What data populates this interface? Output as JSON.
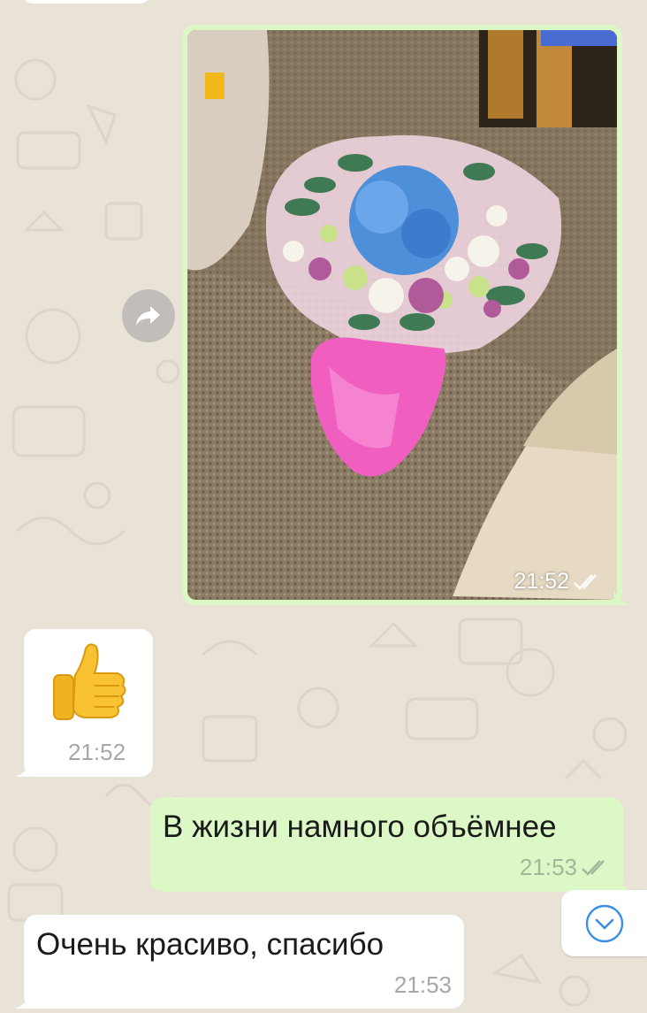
{
  "chat": {
    "messages": [
      {
        "type": "image",
        "direction": "outgoing",
        "time": "21:52",
        "status": "read",
        "image_desc": "photo-bouquet"
      },
      {
        "type": "sticker",
        "direction": "incoming",
        "time": "21:52",
        "sticker_icon": "thumbs-up-icon"
      },
      {
        "type": "text",
        "direction": "outgoing",
        "text": "В жизни намного объёмнее",
        "time": "21:53",
        "status": "read"
      },
      {
        "type": "text",
        "direction": "incoming",
        "text": "Очень красиво, спасибо",
        "time": "21:53"
      }
    ]
  },
  "colors": {
    "wallpaper": "#e9e2d7",
    "outgoing_bubble": "#dcf8c6",
    "incoming_bubble": "#ffffff",
    "read_check": "#ffffff",
    "scroll_icon": "#3b8ee6"
  },
  "icons": {
    "forward": "forward-arrow-icon",
    "scroll_down": "chevron-down-icon",
    "read_receipt": "double-check-icon"
  }
}
